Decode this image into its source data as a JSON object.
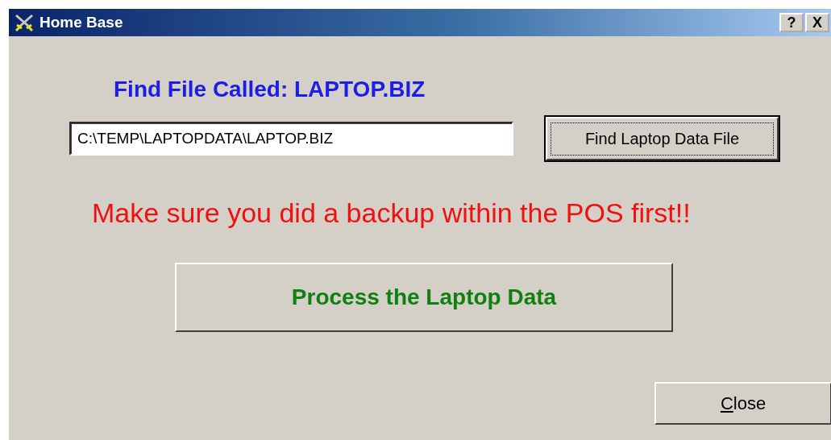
{
  "window": {
    "title": "Home Base",
    "title_buttons": [
      "?",
      "X"
    ]
  },
  "heading": "Find File Called: LAPTOP.BIZ",
  "file_path": {
    "value": "C:\\TEMP\\LAPTOPDATA\\LAPTOP.BIZ"
  },
  "find_button": {
    "label": "Find Laptop Data File",
    "focused": true
  },
  "warning": "Make sure you did a backup within the POS first!!",
  "process_button": {
    "label": "Process the Laptop Data"
  },
  "close_button": {
    "label": "Close",
    "first_letter_underlined": true
  }
}
